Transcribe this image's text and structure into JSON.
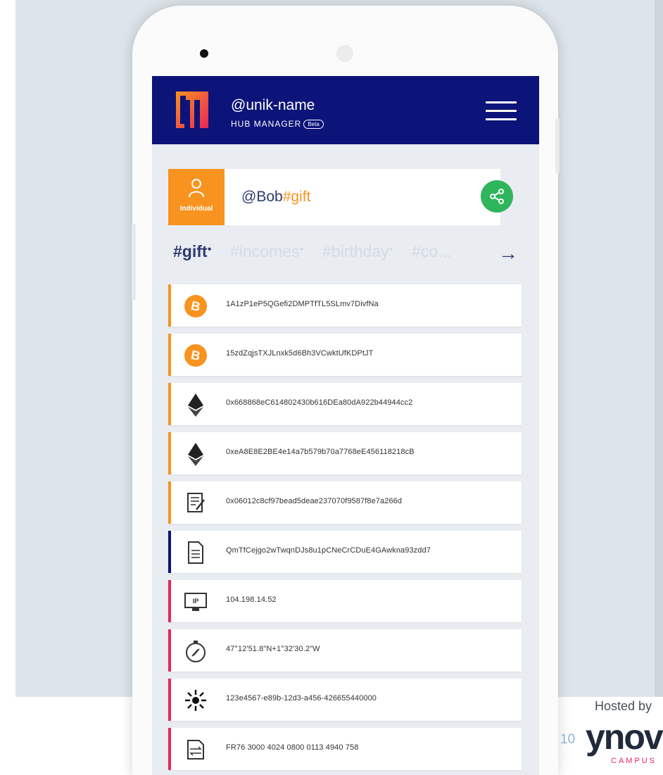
{
  "app": {
    "brand": "@unik-name",
    "subtitle": "HUB MANAGER",
    "beta": "Beta"
  },
  "profile": {
    "type": "Individual",
    "name": "@Bob",
    "tag": "#gift"
  },
  "tags": [
    "#gift",
    "#incomes",
    "#birthday",
    "#co..."
  ],
  "items": [
    {
      "icon": "bitcoin-icon",
      "value": "1A1zP1eP5QGefi2DMPTfTL5SLmv7DivfNa",
      "accent": "#f7931e"
    },
    {
      "icon": "bitcoin-icon",
      "value": "15zdZqjsTXJLnxk5d6Bh3VCwktUfKDPtJT",
      "accent": "#f7931e"
    },
    {
      "icon": "ethereum-icon",
      "value": "0x668868eC614802430b616DEa80dA922b44944cc2",
      "accent": "#f7931e"
    },
    {
      "icon": "ethereum-icon",
      "value": "0xeA8E8E2BE4e14a7b579b70a7768eE456118218cB",
      "accent": "#f7931e"
    },
    {
      "icon": "contract-icon",
      "value": "0x06012c8cf97bead5deae237070f9587f8e7a266d",
      "accent": "#f7931e"
    },
    {
      "icon": "document-icon",
      "value": "QmTfCejgo2wTwqnDJs8u1pCNeCrCDuE4GAwkna93zdd7",
      "accent": "#0c1479"
    },
    {
      "icon": "ip-monitor-icon",
      "value": "104.198.14.52",
      "accent": "#e8265a"
    },
    {
      "icon": "compass-icon",
      "value": "47°12'51.8\"N+1°32'30.2\"W",
      "accent": "#e8265a"
    },
    {
      "icon": "uuid-icon",
      "value": "123e4567-e89b-12d3-a456-426655440000",
      "accent": "#e8265a"
    },
    {
      "icon": "bank-transfer-icon",
      "value": "FR76 3000 4024 0800 0113 4940 758",
      "accent": "#e8265a"
    }
  ],
  "footer": {
    "hosted_by": "Hosted by",
    "page_number": "10",
    "logo_text": "ynov",
    "logo_sub": "CAMPUS"
  }
}
